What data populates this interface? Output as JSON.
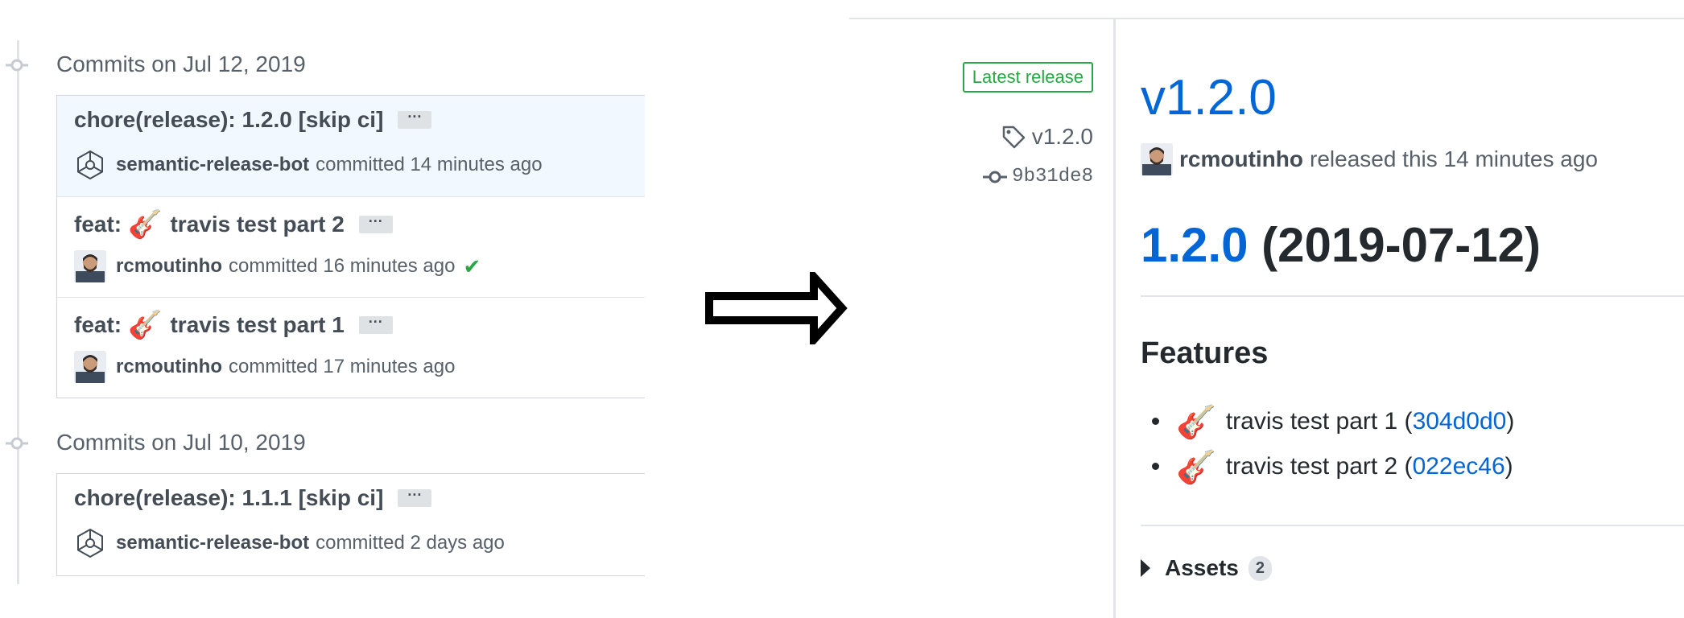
{
  "commit_groups": [
    {
      "title": "Commits on Jul 12, 2019",
      "commits": [
        {
          "message": "chore(release): 1.2.0 [skip ci]",
          "author": "semantic-release-bot",
          "time": "committed 14 minutes ago",
          "avatar": "bot-hexagon-icon",
          "status": ""
        },
        {
          "message_prefix": "feat:",
          "message": "travis test part 2",
          "emoji": "🎸",
          "author": "rcmoutinho",
          "time": "committed 16 minutes ago",
          "avatar": "user-avatar",
          "status": "✔"
        },
        {
          "message_prefix": "feat:",
          "message": "travis test part 1",
          "emoji": "🎸",
          "author": "rcmoutinho",
          "time": "committed 17 minutes ago",
          "avatar": "user-avatar",
          "status": ""
        }
      ]
    },
    {
      "title": "Commits on Jul 10, 2019",
      "commits": [
        {
          "message": "chore(release): 1.1.1 [skip ci]",
          "author": "semantic-release-bot",
          "time": "committed 2 days ago",
          "avatar": "bot-hexagon-icon",
          "status": ""
        }
      ]
    }
  ],
  "ellipsis_label": "···",
  "release": {
    "badge": "Latest release",
    "tag": "v1.2.0",
    "sha": "9b31de8",
    "title": "v1.2.0",
    "author": "rcmoutinho",
    "released_text": "released this 14 minutes ago",
    "version_link": "1.2.0",
    "version_date": "(2019-07-12)",
    "features_heading": "Features",
    "features": [
      {
        "emoji": "🎸",
        "text": "travis test part 1 (",
        "hash": "304d0d0",
        "close": ")"
      },
      {
        "emoji": "🎸",
        "text": "travis test part 2 (",
        "hash": "022ec46",
        "close": ")"
      }
    ],
    "assets_label": "Assets",
    "assets_count": "2"
  },
  "colors": {
    "link": "#0366d6",
    "success": "#28a745",
    "muted": "#586069"
  }
}
